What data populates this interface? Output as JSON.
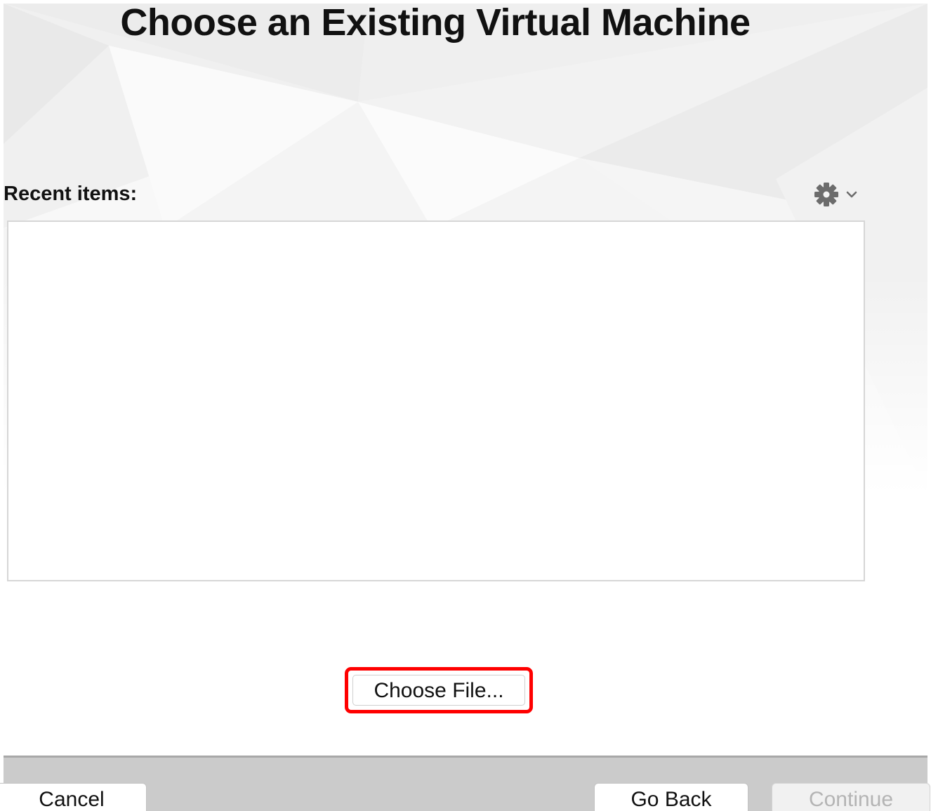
{
  "window": {
    "title": "Choose an Existing Virtual Machine"
  },
  "recent": {
    "label": "Recent items:",
    "items": [],
    "options_icon": "gear-icon",
    "options_chevron_icon": "chevron-down-icon"
  },
  "actions": {
    "choose_file_label": "Choose File...",
    "highlight_color": "#ff0000"
  },
  "footer": {
    "cancel_label": "Cancel",
    "go_back_label": "Go Back",
    "continue_label": "Continue",
    "continue_enabled": false
  }
}
